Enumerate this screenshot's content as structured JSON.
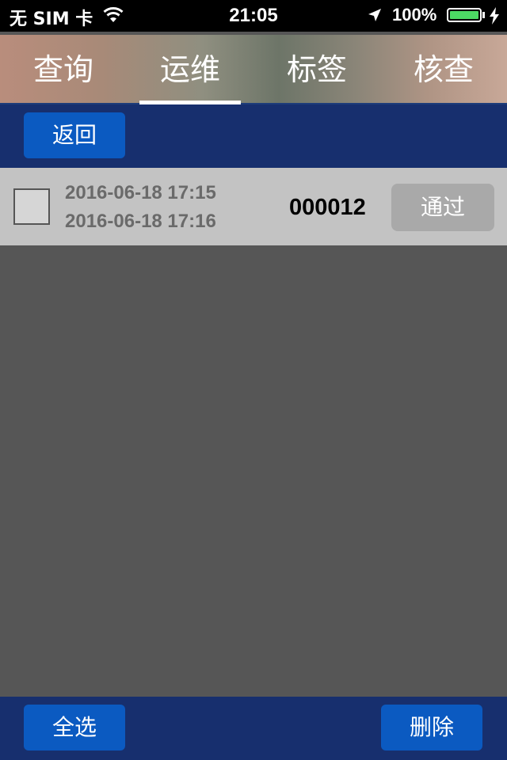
{
  "status_bar": {
    "carrier": "无 SIM 卡",
    "time": "21:05",
    "battery": "100%",
    "icons": [
      "wifi-icon",
      "location-arrow-icon",
      "battery-icon",
      "charging-bolt-icon"
    ]
  },
  "tabs": [
    {
      "label": "查询",
      "active": false
    },
    {
      "label": "运维",
      "active": true
    },
    {
      "label": "标签",
      "active": false
    },
    {
      "label": "核查",
      "active": false
    }
  ],
  "toolbar": {
    "back_label": "返回"
  },
  "list": {
    "items": [
      {
        "time_start": "2016-06-18 17:15",
        "time_end": "2016-06-18 17:16",
        "code": "000012",
        "action_label": "通过",
        "checked": false
      }
    ]
  },
  "bottom_bar": {
    "select_all_label": "全选",
    "delete_label": "删除"
  },
  "colors": {
    "nav_blue": "#172f6e",
    "button_blue": "#0b5ac1",
    "row_bg": "#c3c3c3",
    "content_bg": "#565656",
    "battery_green": "#4cd964"
  }
}
